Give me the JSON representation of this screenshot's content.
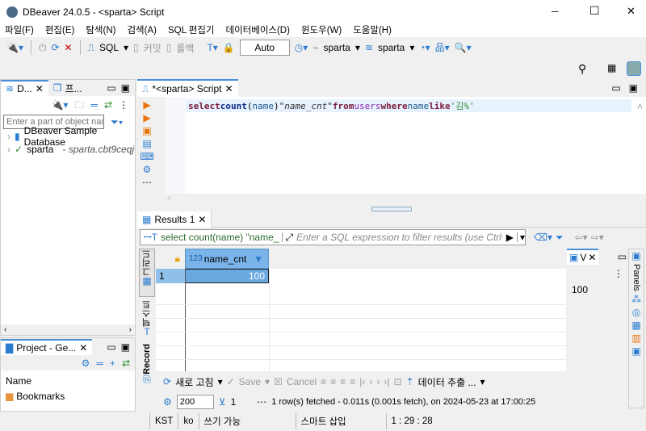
{
  "window": {
    "title": "DBeaver 24.0.5 - <sparta> Script",
    "minimize": "─",
    "maximize": "☐",
    "close": "✕"
  },
  "menu": [
    "파일(F)",
    "편집(E)",
    "탐색(N)",
    "검색(A)",
    "SQL 편집기",
    "데이터베이스(D)",
    "윈도우(W)",
    "도움말(H)"
  ],
  "toolbar": {
    "sql": "SQL",
    "commit": "커밋",
    "rollback": "롤백",
    "mode": "Auto",
    "datasource": "sparta",
    "schema": "sparta"
  },
  "navigator": {
    "tab1": "D...",
    "tab2": "프...",
    "filter_placeholder": "Enter a part of object name",
    "tree": [
      {
        "label": "DBeaver Sample Database"
      },
      {
        "label": "sparta",
        "detail": "- sparta.cbt9ceqjwl..."
      }
    ]
  },
  "project": {
    "tab": "Project - Ge...",
    "column": "Name",
    "items": [
      "Bookmarks"
    ]
  },
  "editor": {
    "tab": "*<sparta> Script",
    "code": {
      "select": "select",
      "count": "count",
      "paren_open": "(",
      "name": "name",
      "paren_close": ")",
      "alias": "\"name_cnt\"",
      "from": "from",
      "table": "users",
      "where": "where",
      "col": "name",
      "like": "like",
      "literal": "'김%'"
    }
  },
  "results": {
    "tab": "Results 1",
    "query": "select count(name) \"name_",
    "filter_placeholder": "Enter a SQL expression to filter results (use Ctrl+Space)",
    "column": {
      "type": "123",
      "name": "name_cnt"
    },
    "rows": [
      {
        "num": "1",
        "value": "100"
      }
    ],
    "side_tabs": {
      "grid": "그리드",
      "text": "텍스트",
      "record": "Record"
    },
    "value_panel": {
      "tab": "V",
      "value": "100"
    },
    "panels": "Panels"
  },
  "bottom": {
    "refresh": "새로 고침",
    "save": "Save",
    "cancel": "Cancel",
    "export": "데이터 추출 ...",
    "fetch_size": "200",
    "row_count": "1",
    "status": "1 row(s) fetched - 0.011s (0.001s fetch), on 2024-05-23 at 17:00:25"
  },
  "statusbar": {
    "tz": "KST",
    "lang": "ko",
    "writable": "쓰기 가능",
    "insert": "스마트 삽입",
    "position": "1 : 29 : 28"
  }
}
